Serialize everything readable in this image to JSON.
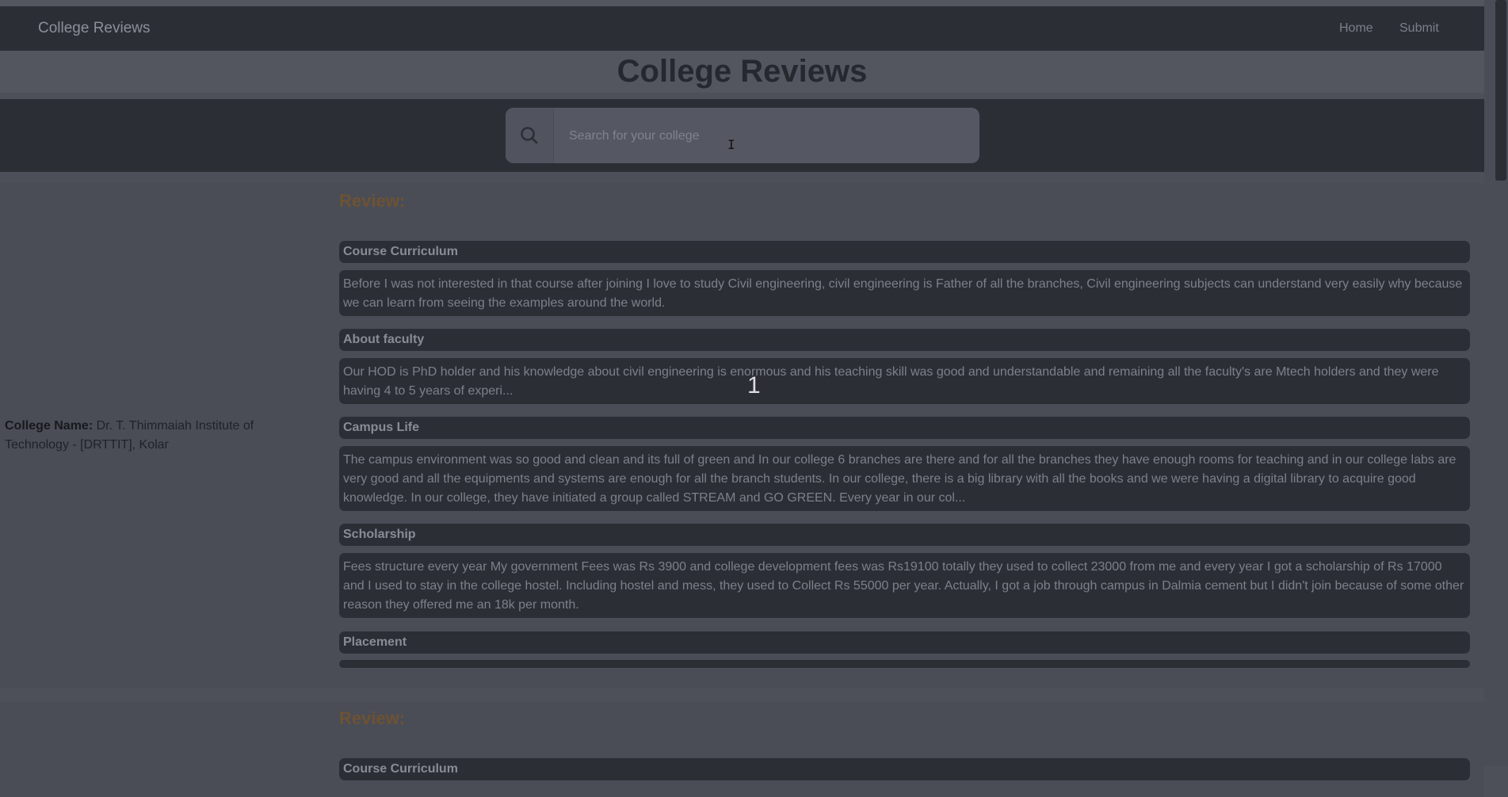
{
  "navbar": {
    "brand": "College Reviews",
    "links": [
      "Home",
      "Submit"
    ]
  },
  "page": {
    "title": "College Reviews"
  },
  "search": {
    "placeholder": "Search for your college",
    "value": ""
  },
  "reviews": [
    {
      "college_label": "College Name:",
      "college_name": "Dr. T. Thimmaiah Institute of Technology - [DRTTIT], Kolar",
      "heading": "Review:",
      "sections": [
        {
          "title": "Course Curriculum",
          "body": "Before I was not interested in that course after joining I love to study Civil engineering, civil engineering is Father of all the branches, Civil engineering subjects can understand very easily why because we can learn from seeing the examples around the world."
        },
        {
          "title": "About faculty",
          "body": "Our HOD is PhD holder and his knowledge about civil engineering is enormous and his teaching skill was good and understandable and remaining all the faculty's are Mtech holders and they were having 4 to 5 years of experi..."
        },
        {
          "title": "Campus Life",
          "body": "The campus environment was so good and clean and its full of green and In our college 6 branches are there and for all the branches they have enough rooms for teaching and in our college labs are very good and all the equipments and systems are enough for all the branch students. In our college, there is a big library with all the books and we were having a digital library to acquire good knowledge. In our college, they have initiated a group called STREAM and GO GREEN. Every year in our col..."
        },
        {
          "title": "Scholarship",
          "body": "Fees structure every year My government Fees was Rs 3900 and college development fees was Rs19100 totally they used to collect 23000 from me and every year I got a scholarship of Rs 17000 and I used to stay in the college hostel. Including hostel and mess, they used to Collect Rs 55000 per year. Actually, I got a job through campus in Dalmia cement but I didn't join because of some other reason they offered me an 18k per month."
        },
        {
          "title": "Placement",
          "body": ""
        }
      ]
    },
    {
      "heading": "Review:",
      "sections": [
        {
          "title": "Course Curriculum"
        }
      ]
    }
  ],
  "overlay": {
    "slide_number": "1"
  }
}
